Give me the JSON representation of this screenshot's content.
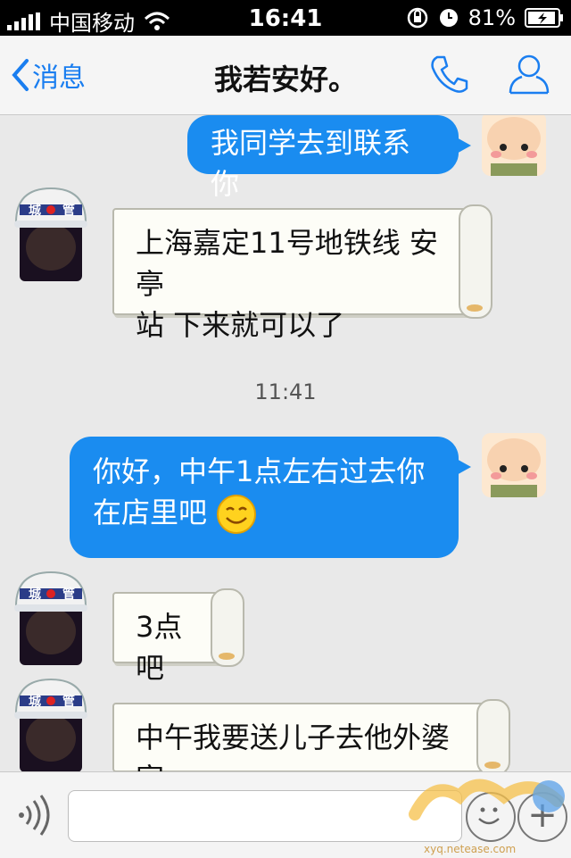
{
  "status": {
    "carrier": "中国移动",
    "time": "16:41",
    "battery": "81%"
  },
  "nav": {
    "back_label": "消息",
    "title": "我若安好。"
  },
  "avatars": {
    "them_helmet_text_1": "城",
    "them_helmet_text_2": "管"
  },
  "messages": [
    {
      "from": "me",
      "text": "我同学去到联系你"
    },
    {
      "from": "them",
      "line1": "上海嘉定11号地铁线 安亭",
      "line2": "站 下来就可以了"
    },
    {
      "from": "time",
      "text": "11:41"
    },
    {
      "from": "me",
      "line1": "你好，中午1点左右过去你",
      "line2": "在店里吧"
    },
    {
      "from": "them",
      "text": "3点吧"
    },
    {
      "from": "them",
      "text": "中午我要送儿子去他外婆家"
    }
  ],
  "input": {
    "plus_label": "+"
  },
  "watermark": {
    "url": "xyq.netease.com"
  },
  "colors": {
    "accent": "#1a7ef0",
    "bubble_me": "#1a8cf0"
  }
}
